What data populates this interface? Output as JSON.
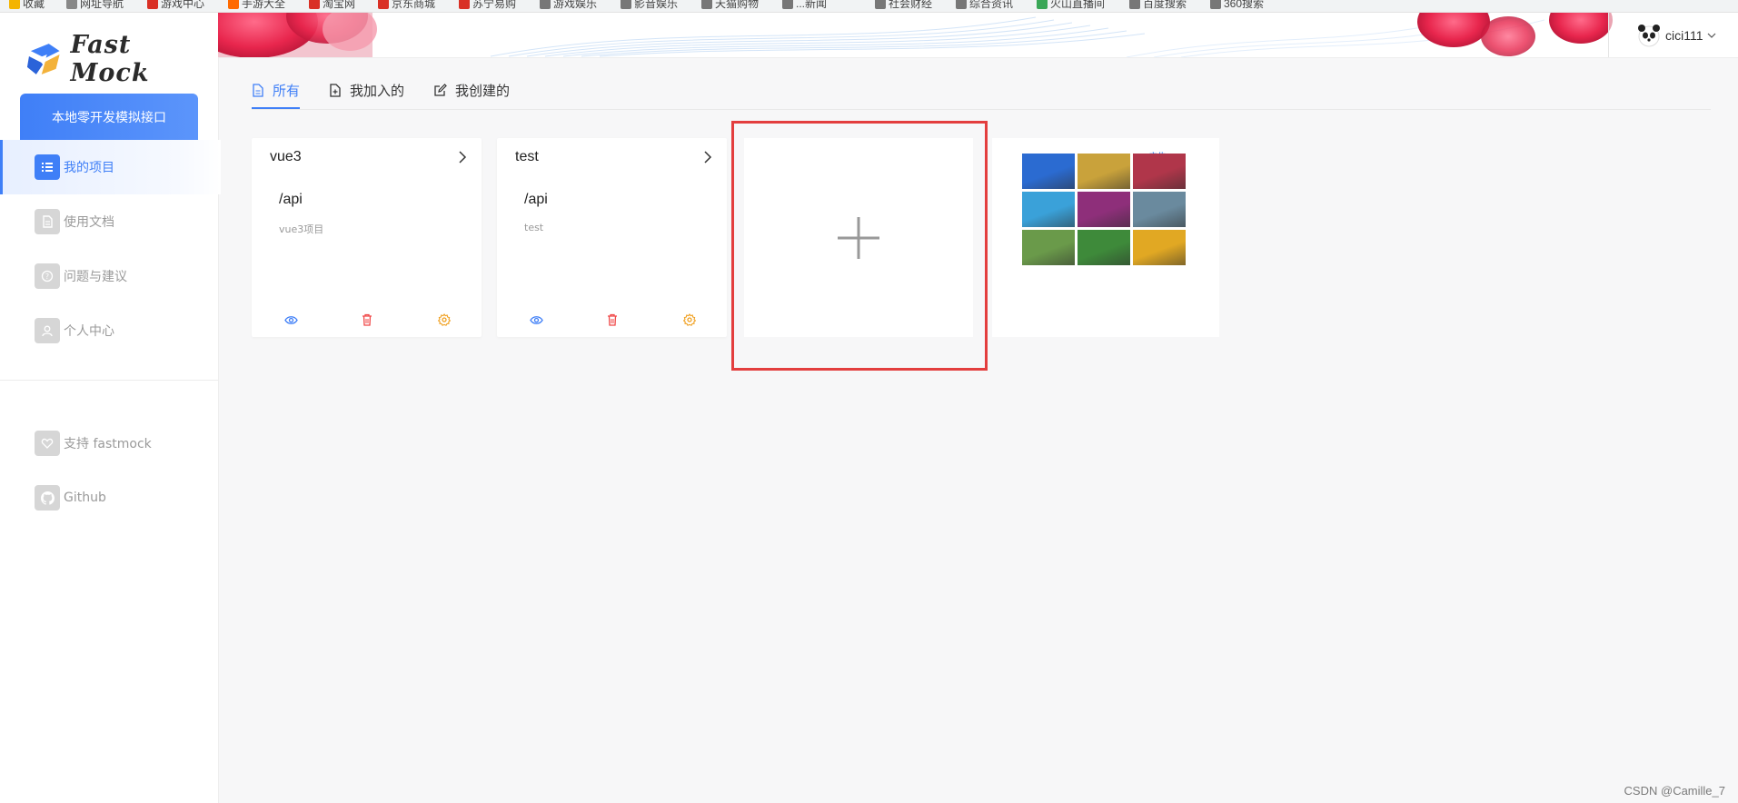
{
  "browser": {
    "bookmarks": [
      {
        "label": "收藏",
        "icon": "star-icon",
        "color": "#f4b400"
      },
      {
        "label": "网址导航",
        "icon": "globe-icon",
        "color": "#888888"
      },
      {
        "label": "游戏中心",
        "icon": "game-icon",
        "color": "#d93025"
      },
      {
        "label": "手游大全",
        "icon": "app-icon",
        "color": "#ff6a00"
      },
      {
        "label": "淘宝网",
        "icon": "taobao-icon",
        "color": "#d93025"
      },
      {
        "label": "京东商城",
        "icon": "jd-icon",
        "color": "#d93025"
      },
      {
        "label": "苏宁易购",
        "icon": "suning-icon",
        "color": "#d93025"
      },
      {
        "label": "游戏娱乐",
        "icon": "folder-icon",
        "color": "#777777"
      },
      {
        "label": "影音娱乐",
        "icon": "folder-icon",
        "color": "#777777"
      },
      {
        "label": "天猫购物",
        "icon": "folder-icon",
        "color": "#777777"
      },
      {
        "label": "...新闻",
        "icon": "folder-icon",
        "color": "#777777"
      },
      {
        "label": "社会财经",
        "icon": "folder-icon",
        "color": "#777777"
      },
      {
        "label": "综合资讯",
        "icon": "folder-icon",
        "color": "#777777"
      },
      {
        "label": "火山直播间",
        "icon": "leaf-icon",
        "color": "#3aa757"
      },
      {
        "label": "百度搜索",
        "icon": "folder-icon",
        "color": "#777777"
      },
      {
        "label": "360搜索",
        "icon": "folder-icon",
        "color": "#777777"
      }
    ]
  },
  "sidebar": {
    "logo_text": "Fast Mock",
    "local_button": "本地零开发模拟接口",
    "nav": [
      {
        "label": "我的项目",
        "icon": "list-icon",
        "active": true
      },
      {
        "label": "使用文档",
        "icon": "document-icon",
        "active": false
      },
      {
        "label": "问题与建议",
        "icon": "question-icon",
        "active": false
      },
      {
        "label": "个人中心",
        "icon": "user-icon",
        "active": false
      }
    ],
    "links": [
      {
        "label": "支持 fastmock",
        "icon": "heart-icon"
      },
      {
        "label": "Github",
        "icon": "github-icon"
      }
    ]
  },
  "header": {
    "username": "cici111",
    "user_dropdown_icon": "chevron-down-icon"
  },
  "tabs": [
    {
      "label": "所有",
      "icon": "file-icon",
      "active": true
    },
    {
      "label": "我加入的",
      "icon": "file-add-icon",
      "active": false
    },
    {
      "label": "我创建的",
      "icon": "edit-icon",
      "active": false
    }
  ],
  "projects": [
    {
      "name": "vue3",
      "root_path": "/api",
      "description": "vue3项目"
    },
    {
      "name": "test",
      "root_path": "/api",
      "description": "test"
    }
  ],
  "project_actions": [
    {
      "icon": "eye-icon",
      "color": "#3f7ff7"
    },
    {
      "icon": "trash-icon",
      "color": "#f04848"
    },
    {
      "icon": "settings-icon",
      "color": "#f0a020"
    }
  ],
  "add_card": {
    "icon": "plus-icon"
  },
  "ad": {
    "label": "广告",
    "tile_colors": [
      "#2b6bd1",
      "#c9a23b",
      "#b0364a",
      "#3aa1d9",
      "#8e2f7a",
      "#6a8a9e",
      "#6a9a4a",
      "#3e8a3a",
      "#e1a823"
    ]
  },
  "colors": {
    "accent": "#3f7ff7",
    "highlight_box": "#e33e3e"
  },
  "watermark": "CSDN @Camille_7"
}
